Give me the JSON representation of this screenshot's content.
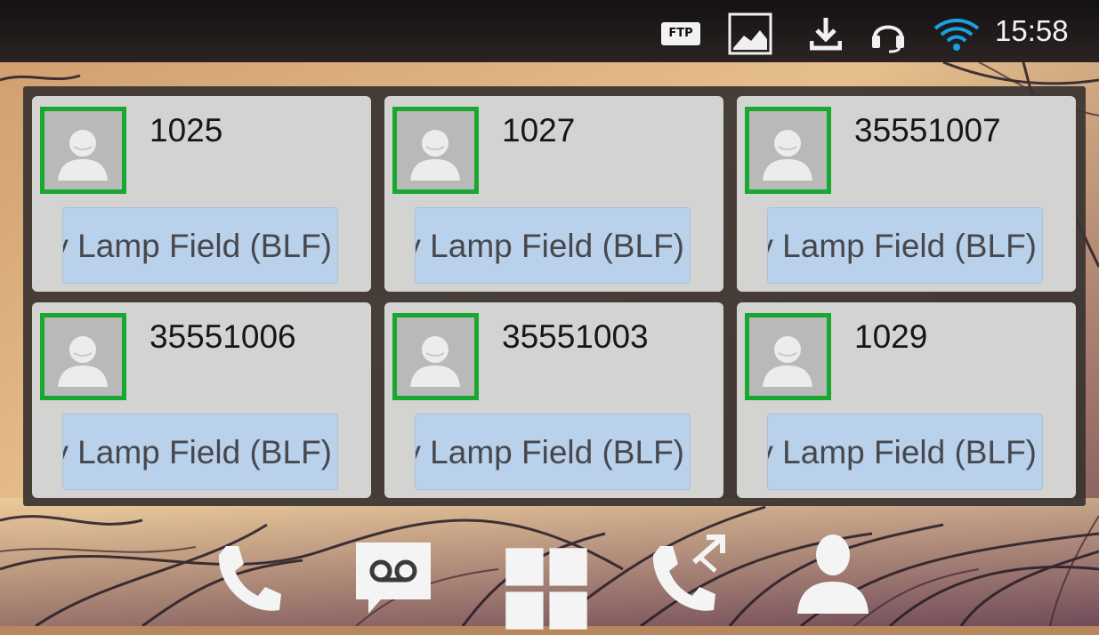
{
  "status_bar": {
    "icons": [
      "ftp-icon",
      "image-icon",
      "download-icon",
      "headset-icon",
      "wifi-icon"
    ],
    "ftp_label": "FTP",
    "time": "15:58"
  },
  "blf_panel": {
    "cards": [
      {
        "number": "1025",
        "button_label": "Busy Lamp Field (BLF)"
      },
      {
        "number": "1027",
        "button_label": "Busy Lamp Field (BLF)"
      },
      {
        "number": "35551007",
        "button_label": "Busy Lamp Field (BLF)"
      },
      {
        "number": "35551006",
        "button_label": "Busy Lamp Field (BLF)"
      },
      {
        "number": "35551003",
        "button_label": "Busy Lamp Field (BLF)"
      },
      {
        "number": "1029",
        "button_label": "Busy Lamp Field (BLF)"
      }
    ]
  },
  "dock": {
    "items": [
      "phone-icon",
      "voicemail-icon",
      "apps-grid-icon",
      "call-transfer-icon",
      "contacts-icon"
    ]
  },
  "colors": {
    "status_bar": "#1b1718",
    "card_bg": "#d3d3d2",
    "avatar_border": "#18a830",
    "blf_button": "#b9d1ea",
    "panel_bg": "#3a3432"
  }
}
